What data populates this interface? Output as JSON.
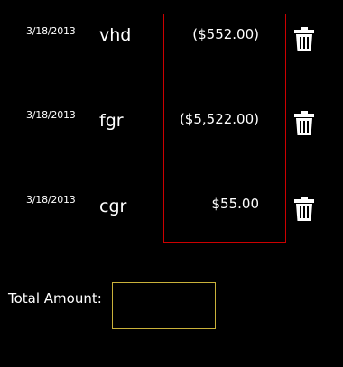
{
  "transactions": [
    {
      "date": "3/18/2013",
      "name": "vhd",
      "amount": "($552.00)",
      "delete_icon": "trash-icon"
    },
    {
      "date": "3/18/2013",
      "name": "fgr",
      "amount": "($5,522.00)",
      "delete_icon": "trash-icon"
    },
    {
      "date": "3/18/2013",
      "name": "cgr",
      "amount": "$55.00",
      "delete_icon": "trash-icon"
    }
  ],
  "total": {
    "label": "Total Amount:",
    "value": ""
  },
  "colors": {
    "background": "#000000",
    "text": "#ffffff",
    "amount_box_border": "#cc0000",
    "total_box_border": "#c9b13a"
  }
}
